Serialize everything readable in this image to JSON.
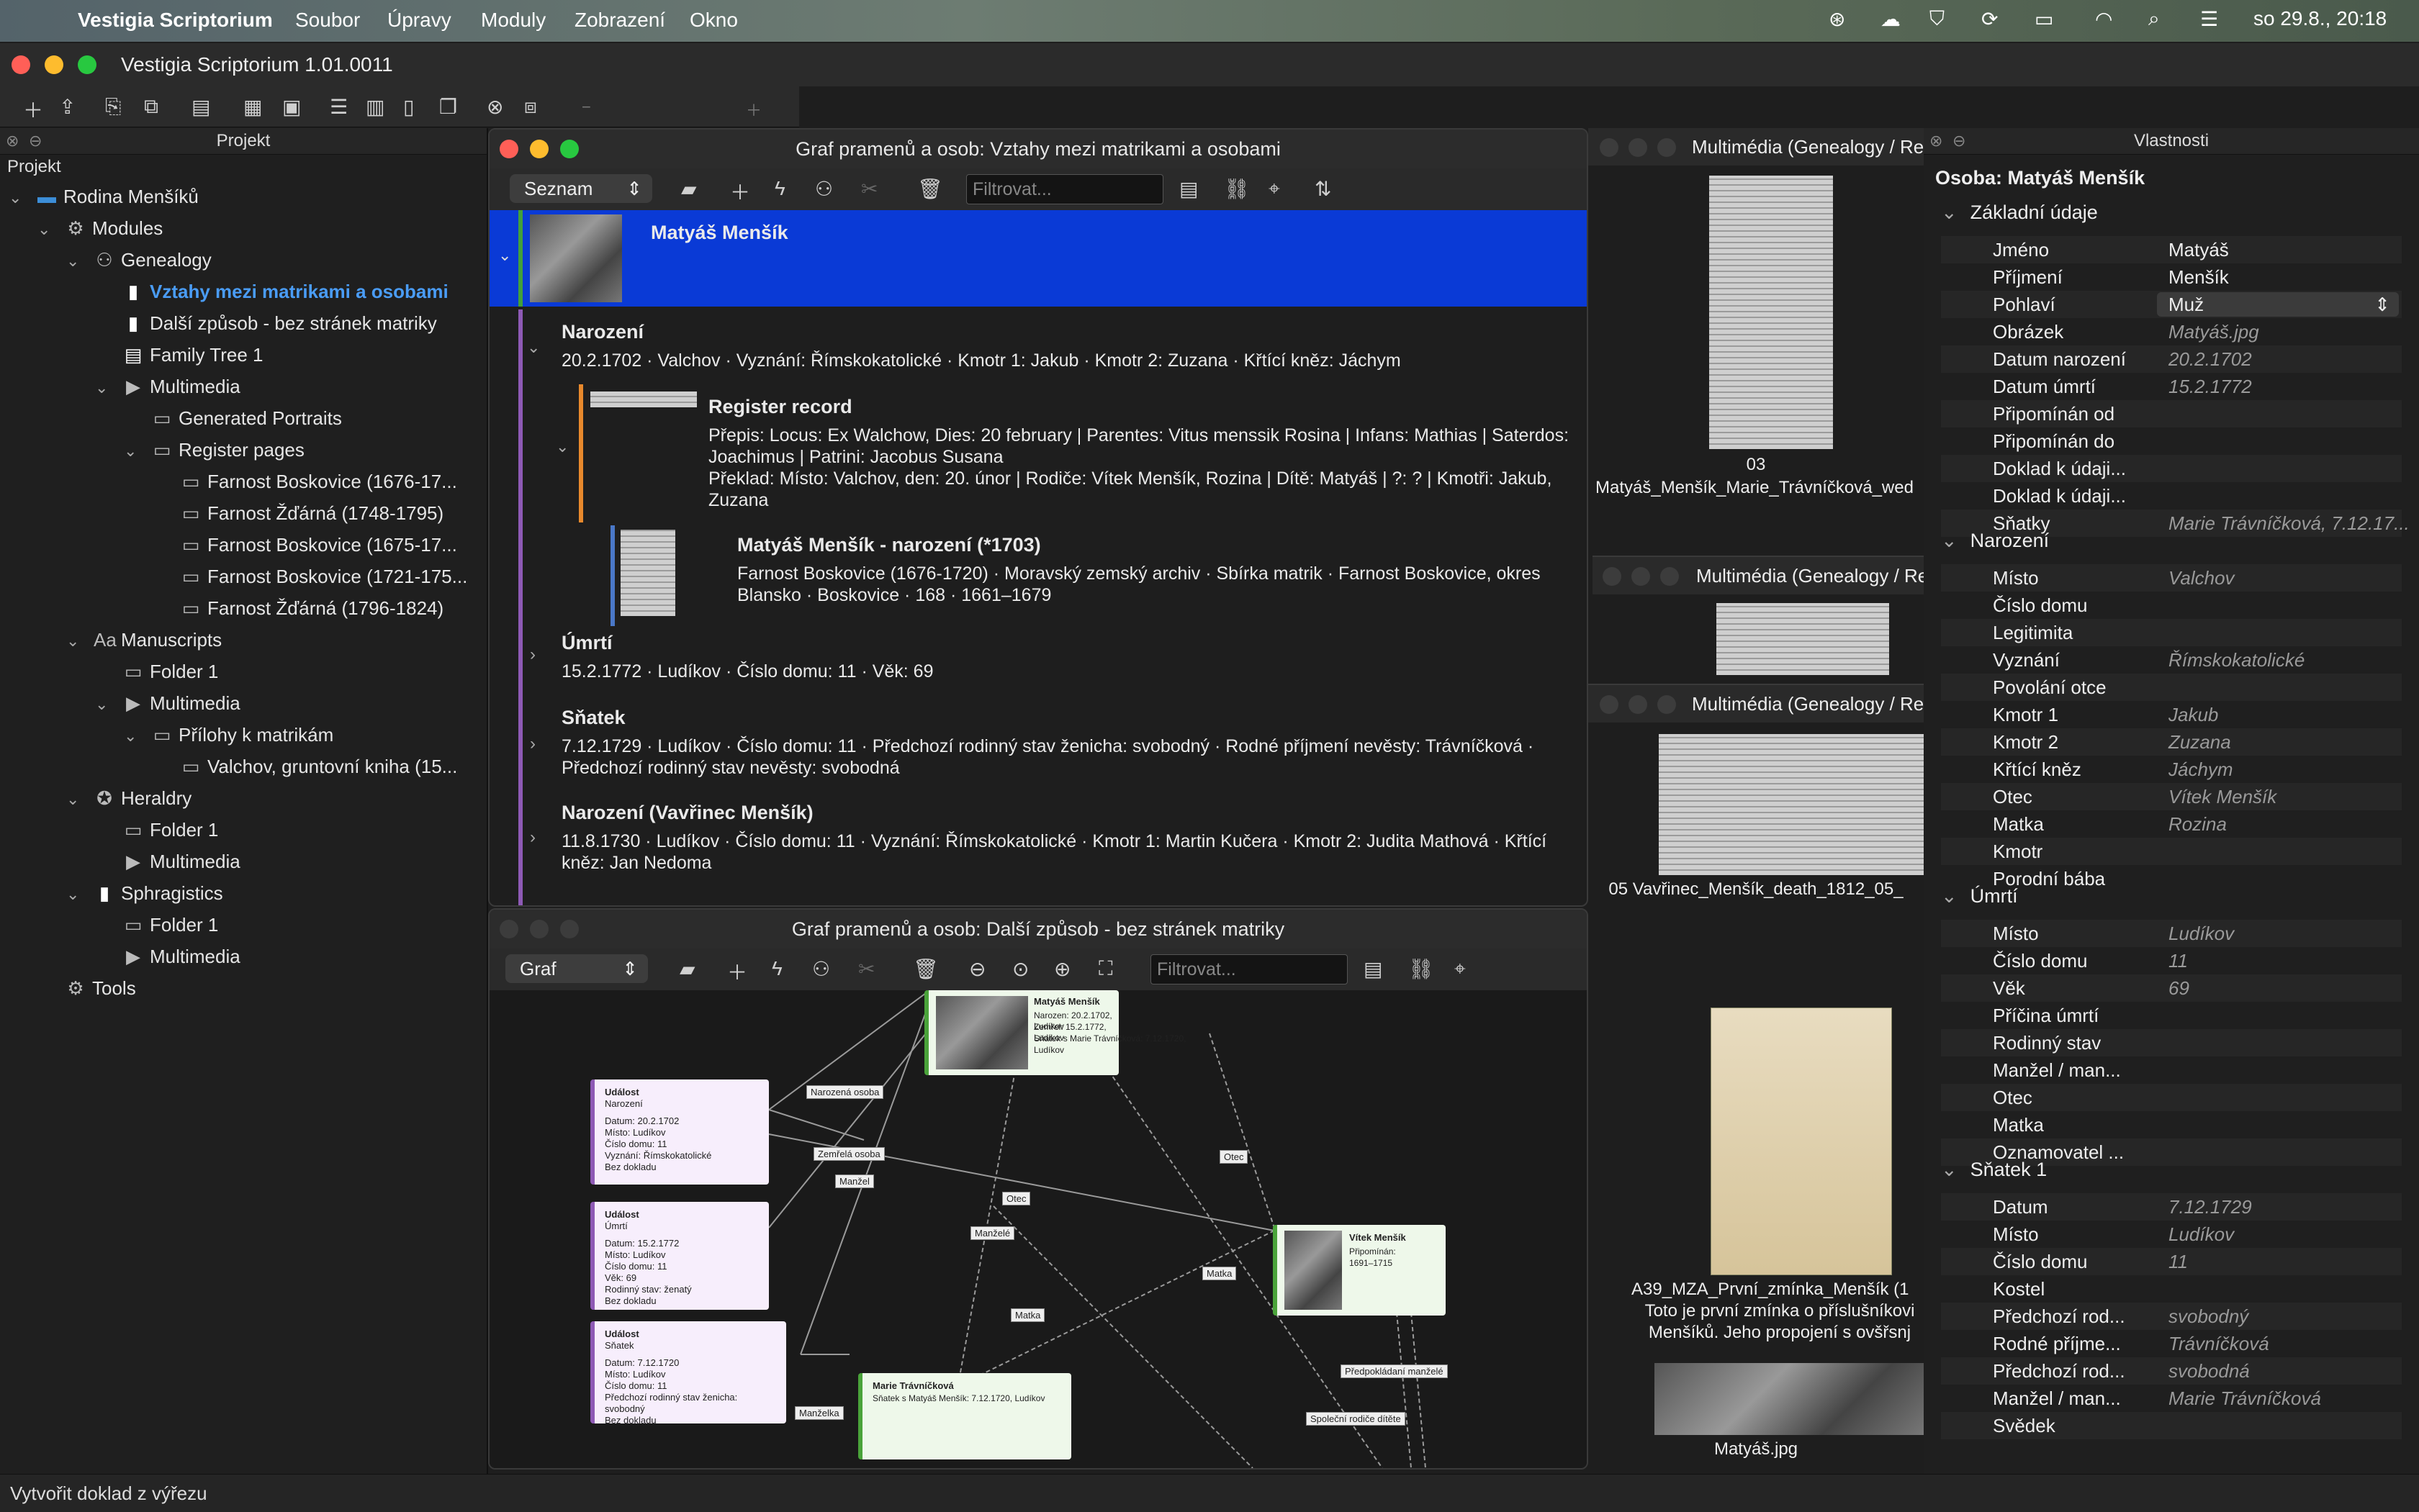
{
  "menubar": {
    "app_name": "Vestigia Scriptorium",
    "items": [
      "Soubor",
      "Úpravy",
      "Moduly",
      "Zobrazení",
      "Okno"
    ],
    "clock": "so 29.8., 20:18"
  },
  "window": {
    "title": "Vestigia Scriptorium 1.01.0011"
  },
  "project_panel": {
    "header": "Projekt",
    "label": "Projekt",
    "tree": {
      "root": "Rodina Menšíků",
      "modules": "Modules",
      "genealogy": "Genealogy",
      "vztahy": "Vztahy mezi matrikami a osobami",
      "dalsi": "Další způsob - bez stránek matriky",
      "family_tree": "Family Tree 1",
      "multimedia": "Multimedia",
      "generated_portraits": "Generated Portraits",
      "register_pages": "Register pages",
      "reg1": "Farnost Boskovice (1676-17...",
      "reg2": "Farnost Žďárná (1748-1795)",
      "reg3": "Farnost Boskovice (1675-17...",
      "reg4": "Farnost Boskovice (1721-175...",
      "reg5": "Farnost Žďárná (1796-1824)",
      "manuscripts": "Manuscripts",
      "ms_folder": "Folder 1",
      "ms_multimedia": "Multimedia",
      "prilohy": "Přílohy k matrikám",
      "valchov": "Valchov, gruntovní kniha (15...",
      "heraldry": "Heraldry",
      "her_folder": "Folder 1",
      "her_multimedia": "Multimedia",
      "sphragistics": "Sphragistics",
      "sph_folder": "Folder 1",
      "sph_multimedia": "Multimedia",
      "tools": "Tools"
    }
  },
  "list_window": {
    "title": "Graf pramenů a osob: Vztahy mezi matrikami a osobami",
    "view_mode": "Seznam",
    "filter_placeholder": "Filtrovat...",
    "person_name": "Matyáš Menšík",
    "birth_title": "Narození",
    "birth_detail": "20.2.1702 · Valchov · Vyznání: Římskokatolické · Kmotr 1: Jakub · Kmotr 2: Zuzana · Křtící kněz: Jáchym",
    "record_title": "Register record",
    "record_line1": "Přepis: Locus: Ex Walchow, Dies: 20 february | Parentes: Vitus menssik Rosina | Infans: Mathias | Saterdos:",
    "record_line2": "Joachimus | Patrini: Jacobus Susana",
    "record_line3": "Překlad: Místo: Valchov, den: 20. únor | Rodiče: Vítek Menšík, Rozina | Dítě: Matyáš | ?: ? | Kmotři: Jakub,",
    "record_line4": "Zuzana",
    "source_title": "Matyáš Menšík - narození (*1703)",
    "source_line1": "Farnost Boskovice (1676-1720) · Moravský zemský archiv · Sbírka matrik · Farnost Boskovice, okres",
    "source_line2": "Blansko · Boskovice · 168 · 1661–1679",
    "death_title": "Úmrtí",
    "death_detail": "15.2.1772 · Ludíkov · Číslo domu: 11 · Věk: 69",
    "marriage_title": "Sňatek",
    "marriage_line1": "7.12.1729 · Ludíkov · Číslo domu: 11 · Předchozí rodinný stav ženicha: svobodný · Rodné příjmení nevěsty: Trávníčková ·",
    "marriage_line2": "Předchozí rodinný stav nevěsty: svobodná",
    "birth2_title": "Narození (Vavřinec Menšík)",
    "birth2_line1": "11.8.1730 · Ludíkov · Číslo domu: 11 · Vyznání: Římskokatolické · Kmotr 1: Martin Kučera · Kmotr 2: Judita Mathová · Křtící",
    "birth2_line2": "kněz: Jan Nedoma"
  },
  "graph_window": {
    "title": "Graf pramenů a osob: Další způsob - bez stránek matriky",
    "view_mode": "Graf",
    "filter_placeholder": "Filtrovat...",
    "event1": {
      "title": "Událost",
      "type": "Narození",
      "l1": "Datum: 20.2.1702",
      "l2": "Místo: Ludíkov",
      "l3": "Číslo domu: 11",
      "l4": "Vyznání: Římskokatolické",
      "l5": "Bez dokladu"
    },
    "event2": {
      "title": "Událost",
      "type": "Úmrtí",
      "l1": "Datum: 15.2.1772",
      "l2": "Místo: Ludíkov",
      "l3": "Číslo domu: 11",
      "l4": "Věk: 69",
      "l5": "Rodinný stav: ženatý",
      "l6": "Bez dokladu"
    },
    "event3": {
      "title": "Událost",
      "type": "Sňatek",
      "l1": "Datum: 7.12.1720",
      "l2": "Místo: Ludíkov",
      "l3": "Číslo domu: 11",
      "l4": "Předchozí rodinný stav ženicha: svobodný",
      "l5": "Bez dokladu"
    },
    "person1": {
      "name": "Matyáš Menšík",
      "l1": "Narozen: 20.2.1702, Ludíkov",
      "l2": "Zemřel: 15.2.1772, Ludíkov",
      "l3": "Sňatek s Marie Trávníčková: 7.12.1720,",
      "l4": "Ludíkov"
    },
    "person2": {
      "name": "Vítek Menšík",
      "l1": "Připomínán:",
      "l2": "1691–1715"
    },
    "person3": {
      "name": "Marie Trávníčková",
      "l1": "Sňatek s Matyáš Menšík: 7.12.1720, Ludíkov"
    },
    "edges": {
      "narozena": "Narozená osoba",
      "zemrela": "Zemřelá osoba",
      "manzel": "Manžel",
      "otec1": "Otec",
      "otec2": "Otec",
      "manzele": "Manželé",
      "matka1": "Matka",
      "matka2": "Matka",
      "manzelka": "Manželka",
      "predpokladani": "Předpokládaní manželé",
      "spolecni": "Společní rodiče dítěte"
    }
  },
  "media_panel": {
    "header1": "Multimédia (Genealogy / Re",
    "cap1a": "03",
    "cap1b": "Matyáš_Menšík_Marie_Trávníčková_wed",
    "header2": "Multimédia (Genealogy / Re",
    "header3": "Multimédia (Genealogy / Re",
    "cap3": "05 Vavřinec_Menšík_death_1812_05_",
    "cap4a": "A39_MZA_První_zmínka_Menšík (1",
    "cap4b": "Toto je první zmínka o příslušníkovi",
    "cap4c": "Menšíků. Jeho propojení s ovšřsnj",
    "cap5": "Matyáš.jpg"
  },
  "properties": {
    "header": "Vlastnosti",
    "subject": "Osoba: Matyáš Menšík",
    "sections": {
      "basic": "Základní údaje",
      "birth": "Narození",
      "death": "Úmrtí",
      "marriage": "Sňatek 1"
    },
    "basic": [
      {
        "k": "Jméno",
        "v": "Matyáš"
      },
      {
        "k": "Příjmení",
        "v": "Menšík"
      },
      {
        "k": "Pohlaví",
        "v": "Muž"
      },
      {
        "k": "Obrázek",
        "v": "Matyáš.jpg"
      },
      {
        "k": "Datum narození",
        "v": "20.2.1702"
      },
      {
        "k": "Datum úmrtí",
        "v": "15.2.1772"
      },
      {
        "k": "Připomínán od",
        "v": ""
      },
      {
        "k": "Připomínán do",
        "v": ""
      },
      {
        "k": "Doklad k údaji...",
        "v": ""
      },
      {
        "k": "Doklad k údaji...",
        "v": ""
      },
      {
        "k": "Sňatky",
        "v": "Marie Trávníčková, 7.12.17..."
      }
    ],
    "birth": [
      {
        "k": "Místo",
        "v": "Valchov"
      },
      {
        "k": "Číslo domu",
        "v": ""
      },
      {
        "k": "Legitimita",
        "v": ""
      },
      {
        "k": "Vyznání",
        "v": "Římskokatolické"
      },
      {
        "k": "Povolání otce",
        "v": ""
      },
      {
        "k": "Kmotr 1",
        "v": "Jakub"
      },
      {
        "k": "Kmotr 2",
        "v": "Zuzana"
      },
      {
        "k": "Křtící kněz",
        "v": "Jáchym"
      },
      {
        "k": "Otec",
        "v": "Vítek Menšík"
      },
      {
        "k": "Matka",
        "v": "Rozina"
      },
      {
        "k": "Kmotr",
        "v": ""
      },
      {
        "k": "Porodní bába",
        "v": ""
      }
    ],
    "death": [
      {
        "k": "Místo",
        "v": "Ludíkov"
      },
      {
        "k": "Číslo domu",
        "v": "11"
      },
      {
        "k": "Věk",
        "v": "69"
      },
      {
        "k": "Příčina úmrtí",
        "v": ""
      },
      {
        "k": "Rodinný stav",
        "v": ""
      },
      {
        "k": "Manžel / man...",
        "v": ""
      },
      {
        "k": "Otec",
        "v": ""
      },
      {
        "k": "Matka",
        "v": ""
      },
      {
        "k": "Oznamovatel ...",
        "v": ""
      }
    ],
    "marriage": [
      {
        "k": "Datum",
        "v": "7.12.1729"
      },
      {
        "k": "Místo",
        "v": "Ludíkov"
      },
      {
        "k": "Číslo domu",
        "v": "11"
      },
      {
        "k": "Kostel",
        "v": ""
      },
      {
        "k": "Předchozí rod...",
        "v": "svobodný"
      },
      {
        "k": "Rodné příjme...",
        "v": "Trávníčková"
      },
      {
        "k": "Předchozí rod...",
        "v": "svobodná"
      },
      {
        "k": "Manžel / man...",
        "v": "Marie Trávníčková"
      },
      {
        "k": "Svědek",
        "v": ""
      }
    ]
  },
  "status": {
    "text": "Vytvořit doklad z výřezu"
  }
}
